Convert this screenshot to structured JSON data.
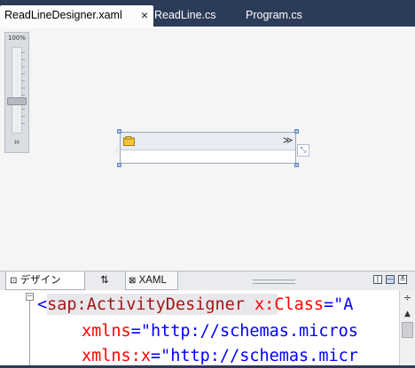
{
  "tabs": [
    {
      "label": "ReadLineDesigner.xaml",
      "active": true,
      "close": "×"
    },
    {
      "label": "ReadLine.cs",
      "active": false
    },
    {
      "label": "Program.cs",
      "active": false
    }
  ],
  "zoom": {
    "label": "100%",
    "fit_glyph": "⌗"
  },
  "activity": {
    "collapse_glyph": "≫",
    "side_glyph": "⤡"
  },
  "view_tabs": {
    "design_label": "デザイン",
    "swap_glyph": "⇅",
    "xaml_label": "XAML",
    "split_h_glyph": "|",
    "split_v_glyph": "—",
    "collapse_glyph": "≚"
  },
  "editor": {
    "outline_glyph": "−",
    "lines": [
      {
        "bracket": "<",
        "tag": "sap:ActivityDesigner",
        "attr": "x:Class",
        "eq": "=",
        "val": "\"A"
      },
      {
        "attr": "xmlns",
        "eq": "=",
        "val": "\"http://schemas.micros"
      },
      {
        "attr": "xmlns:x",
        "eq": "=",
        "val": "\"http://schemas.micr"
      }
    ],
    "scroll_split_glyph": "÷",
    "scroll_up_glyph": "▲"
  },
  "colors": {
    "tab_strip": "#2b3b58",
    "surface": "#f5f5f5",
    "xaml_tag": "#a31515",
    "xaml_attr": "#ff0000",
    "xaml_value": "#0000ff"
  }
}
